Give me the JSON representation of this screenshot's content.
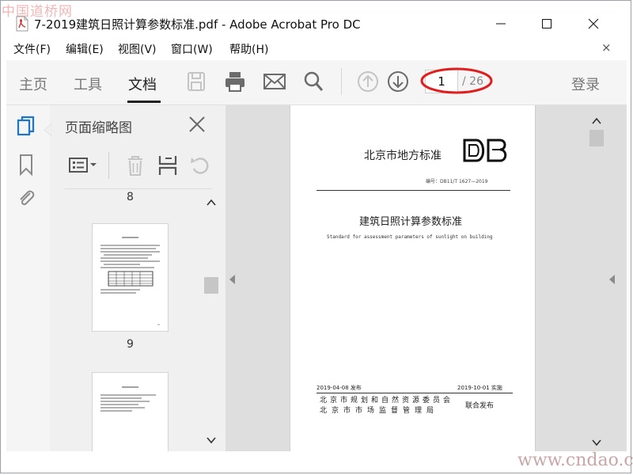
{
  "watermark_top": "中国道桥网",
  "watermark_bottom": "www.cndao.com",
  "window": {
    "title": "7-2019建筑日照计算参数标准.pdf - Adobe Acrobat Pro DC"
  },
  "menu": [
    "文件(F)",
    "编辑(E)",
    "视图(V)",
    "窗口(W)",
    "帮助(H)"
  ],
  "menu_close": "×",
  "toolbar": {
    "tabs": [
      "主页",
      "工具",
      "文档"
    ],
    "active_tab": "文档",
    "page_current": "1",
    "page_total": "/ 26",
    "login": "登录"
  },
  "icons": {
    "rail": [
      "thumbnails-icon",
      "bookmark-icon",
      "attachment-icon"
    ],
    "toolbar": [
      "save-icon",
      "print-icon",
      "email-icon",
      "search-icon",
      "prev-page-icon",
      "next-page-icon"
    ],
    "panel": [
      "options-icon",
      "delete-icon",
      "crop-icon",
      "rotate-icon"
    ]
  },
  "panel": {
    "title": "页面缩略图",
    "page_top": "8",
    "page_mid": "9"
  },
  "document": {
    "authority": "北京市地方标准",
    "logo": "DB",
    "code": "编号：DB11/T 1627—2019",
    "title": "建筑日照计算参数标准",
    "title_en": "Standard for assessment parameters of sunlight on building",
    "issue_date": "2019-04-08 发布",
    "impl_date": "2019-10-01 实施",
    "org1": "北京市规划和自然资源委员会",
    "org2": "北京市市场监督管理局",
    "joint": "联合发布"
  },
  "colors": {
    "accent": "#1b76c9",
    "highlight_ellipse": "#e01e1e",
    "pdf_red": "#d23232"
  }
}
